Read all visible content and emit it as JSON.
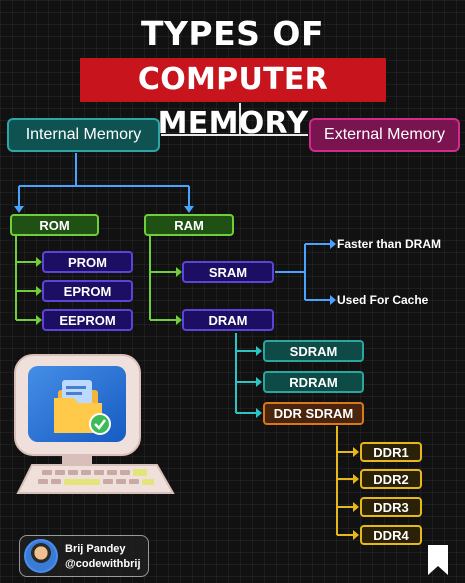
{
  "title": {
    "line1": "TYPES OF",
    "line2": "COMPUTER MEMORY"
  },
  "internal": {
    "label": "Internal Memory"
  },
  "external": {
    "label": "External Memory"
  },
  "rom": {
    "label": "ROM",
    "children": [
      "PROM",
      "EPROM",
      "EEPROM"
    ]
  },
  "ram": {
    "label": "RAM",
    "sram": {
      "label": "SRAM",
      "notes": [
        "Faster than DRAM",
        "Used For Cache"
      ]
    },
    "dram": {
      "label": "DRAM",
      "children": [
        "SDRAM",
        "RDRAM"
      ],
      "ddr": {
        "label": "DDR SDRAM",
        "children": [
          "DDR1",
          "DDR2",
          "DDR3",
          "DDR4"
        ]
      }
    }
  },
  "author": {
    "name": "Brij Pandey",
    "handle": "@codewithbrij"
  },
  "colors": {
    "title_banner": "#c8151d",
    "internal": "#2ea6a6",
    "external": "#d02c8c",
    "rom_ram": "#6fce3a",
    "rom_children": "#5a45d6",
    "dram_children": "#2aa69c",
    "ddr": "#d8771c",
    "ddr_children": "#e6b81a",
    "connector_blue": "#4aa3ff"
  }
}
